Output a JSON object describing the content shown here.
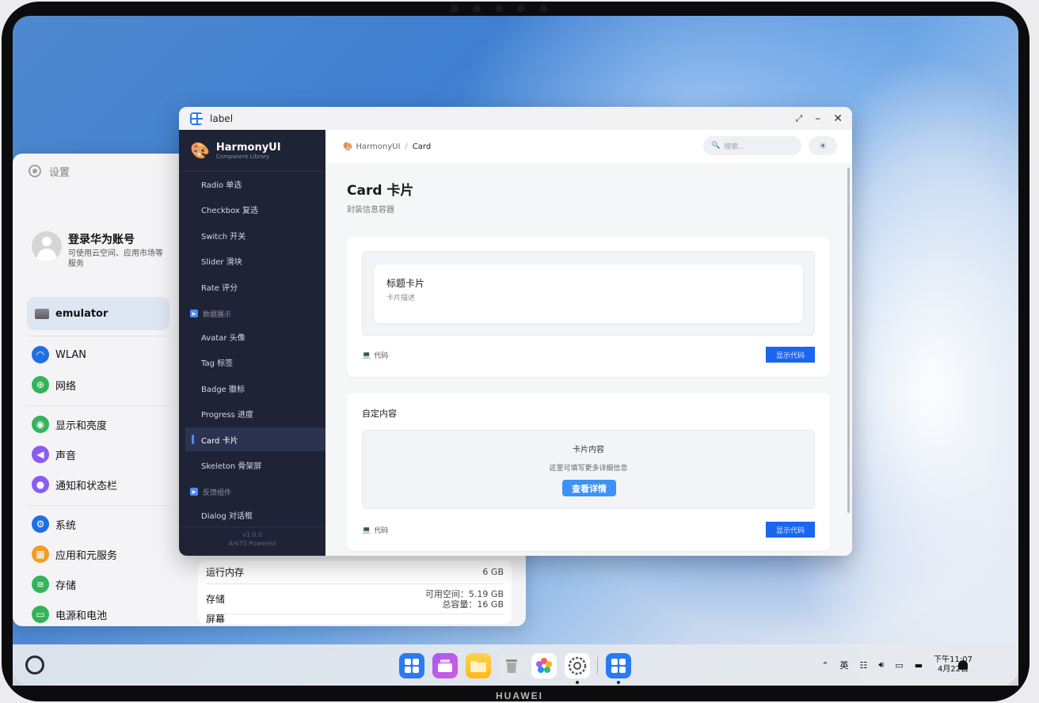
{
  "device": {
    "brand": "HUAWEI"
  },
  "settings_window": {
    "title": "设置",
    "account": {
      "title": "登录华为账号",
      "subtitle": "可使用云空间、应用市场等服务"
    },
    "device_item": "emulator",
    "items": [
      {
        "label": "WLAN",
        "icon": "wifi-icon",
        "color": "#1f6fe5"
      },
      {
        "label": "网络",
        "icon": "network-icon",
        "color": "#33b35a"
      },
      {
        "label": "显示和亮度",
        "icon": "eye-icon",
        "color": "#33b35a"
      },
      {
        "label": "声音",
        "icon": "sound-icon",
        "color": "#8a5cf0"
      },
      {
        "label": "通知和状态栏",
        "icon": "bell-icon",
        "color": "#8a5cf0"
      },
      {
        "label": "系统",
        "icon": "system-icon",
        "color": "#1f6fe5"
      },
      {
        "label": "应用和元服务",
        "icon": "apps-icon",
        "color": "#f59a22"
      },
      {
        "label": "存储",
        "icon": "storage-icon",
        "color": "#33b35a"
      },
      {
        "label": "电源和电池",
        "icon": "battery-icon",
        "color": "#33b35a"
      }
    ],
    "detail": {
      "ram_label": "运行内存",
      "ram_value": "6 GB",
      "storage_label": "存储",
      "storage_free": "可用空间：5.19 GB",
      "storage_total": "总容量：16 GB",
      "screen_label": "屏幕"
    }
  },
  "app_window": {
    "title": "label",
    "brand": {
      "name": "HarmonyUI",
      "tagline": "Component Library"
    },
    "nav": {
      "items_top": [
        "Radio 单选",
        "Checkbox 复选",
        "Switch 开关",
        "Slider 滑块",
        "Rate 评分"
      ],
      "group_data": "数据展示",
      "items_data": [
        "Avatar 头像",
        "Tag 标签",
        "Badge 徽标",
        "Progress 进度",
        "Card 卡片",
        "Skeleton 骨架屏"
      ],
      "active": "Card 卡片",
      "group_feedback": "反馈组件",
      "items_feedback": [
        "Dialog 对话框"
      ]
    },
    "footer": {
      "version": "v1.0.0",
      "powered": "ArkTS Powered"
    },
    "breadcrumb": {
      "root": "HarmonyUI",
      "separator": "/",
      "current": "Card"
    },
    "search": {
      "placeholder": "搜索..."
    },
    "page": {
      "title": "Card 卡片",
      "subtitle": "封装信息容器",
      "demo1": {
        "card_title": "标题卡片",
        "card_desc": "卡片描述",
        "code_label": "代码",
        "show_code": "显示代码"
      },
      "demo2": {
        "heading": "自定内容",
        "content_title": "卡片内容",
        "content_desc": "这里可填写更多详细信息",
        "detail_button": "查看详情",
        "code_label": "代码",
        "show_code": "显示代码"
      }
    }
  },
  "taskbar": {
    "apps": [
      "app-center-icon",
      "multitask-icon",
      "files-icon",
      "trash-icon",
      "gallery-icon",
      "settings-icon",
      "harmonyui-icon"
    ],
    "tray": {
      "ime": "英",
      "time": "下午11:07",
      "date": "4月22日"
    }
  }
}
